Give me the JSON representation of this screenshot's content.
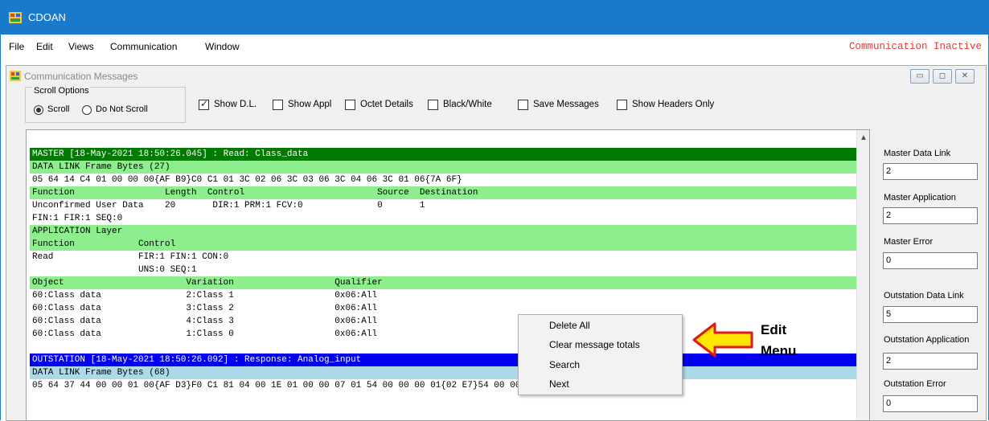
{
  "window": {
    "title": "CDOAN"
  },
  "menubar": {
    "items": [
      "File",
      "Edit",
      "Views",
      "Communication",
      "Window"
    ],
    "status": "Communication Inactive"
  },
  "child": {
    "title": "Communication Messages"
  },
  "scroll_options": {
    "legend": "Scroll Options",
    "scroll_label": "Scroll",
    "no_scroll_label": "Do Not Scroll",
    "selected": "Scroll"
  },
  "checkboxes": {
    "show_dl": {
      "label": "Show D.L.",
      "checked": true
    },
    "show_appl": {
      "label": "Show Appl",
      "checked": false
    },
    "octet_details": {
      "label": "Octet Details",
      "checked": false
    },
    "black_white": {
      "label": "Black/White",
      "checked": false
    },
    "save_messages": {
      "label": "Save Messages",
      "checked": false
    },
    "show_headers_only": {
      "label": "Show Headers Only",
      "checked": false
    }
  },
  "messages": {
    "master_header": "MASTER [18-May-2021 18:50:26.045] : Read: Class_data",
    "dl_frame_master": "DATA LINK Frame Bytes (27)",
    "bytes_master": "05 64 14 C4 01 00 00 00{AF B9}C0 C1 01 3C 02 06 3C 03 06 3C 04 06 3C 01 06{7A 6F}",
    "dl_cols": "Function                 Length  Control                         Source  Destination",
    "dl_vals": "Unconfirmed User Data    20       DIR:1 PRM:1 FCV:0              0       1",
    "fin_line": "FIN:1 FIR:1 SEQ:0",
    "app_layer": "APPLICATION Layer",
    "app_cols": "Function            Control",
    "app_read": "Read                FIR:1 FIN:1 CON:0",
    "app_uns": "                    UNS:0 SEQ:1",
    "obj_cols": "Object                       Variation                   Qualifier",
    "obj_rows": [
      "60:Class data                2:Class 1                   0x06:All",
      "60:Class data                3:Class 2                   0x06:All",
      "60:Class data                4:Class 3                   0x06:All",
      "60:Class data                1:Class 0                   0x06:All"
    ],
    "outst_header": "OUTSTATION [18-May-2021 18:50:26.092] : Response: Analog_input",
    "dl_frame_outst": "DATA LINK Frame Bytes (68)",
    "bytes_outst": "05 64 37 44 00 00 01 00{AF D3}F0 C1 81 04 00 1E 01 00 00 07 01 54 00 00 00 01{02 E7}54 00 00 00"
  },
  "side_panel": {
    "master_data_link": {
      "label": "Master Data Link",
      "value": "2"
    },
    "master_application": {
      "label": "Master Application",
      "value": "2"
    },
    "master_error": {
      "label": "Master Error",
      "value": "0"
    },
    "outstation_data_link": {
      "label": "Outstation Data Link",
      "value": "5"
    },
    "outstation_application": {
      "label": "Outstation Application",
      "value": "2"
    },
    "outstation_error": {
      "label": "Outstation Error",
      "value": "0"
    }
  },
  "context_menu": {
    "items": [
      "Delete All",
      "Clear message totals",
      "Search",
      "Next"
    ]
  },
  "annotation": {
    "line1": "Edit",
    "line2": "Menu"
  },
  "colors": {
    "titlebar": "#1979ca",
    "master_header": "#007a00",
    "outst_header": "#0000ee",
    "light_green": "#8cee8c",
    "light_blue": "#add8e6",
    "status_red": "#e53935"
  }
}
